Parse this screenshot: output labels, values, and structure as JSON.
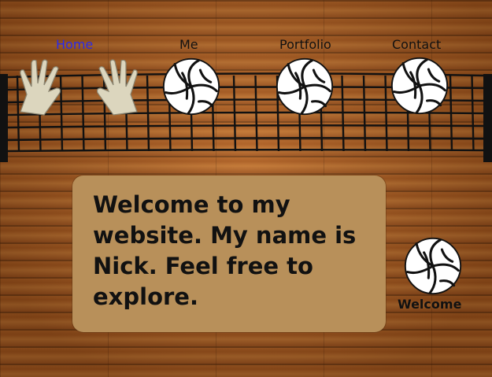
{
  "nav": {
    "items": [
      {
        "label": "Home",
        "active": true
      },
      {
        "label": "Me",
        "active": false
      },
      {
        "label": "Portfolio",
        "active": false
      },
      {
        "label": "Contact",
        "active": false
      }
    ]
  },
  "main": {
    "welcome_text": "Welcome to my website. My name is Nick. Feel free to explore.",
    "caption": "Welcome"
  },
  "colors": {
    "active_link": "#2a2ae8",
    "text": "#111111",
    "panel": "#b8905a"
  },
  "icons": [
    "gloves-icon",
    "volleyball-icon"
  ]
}
